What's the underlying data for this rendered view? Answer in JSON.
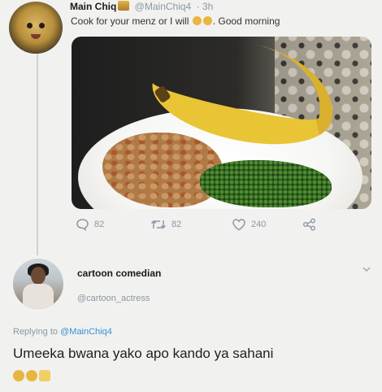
{
  "tweet": {
    "author_name": "Main Chiq",
    "handle": "@MainChiq4",
    "time": "· 3h",
    "text_a": "Cook for your menz or I will",
    "text_b": ". Good morning",
    "icons": {
      "badge": "gold-badge-icon",
      "emoji": "grinning-emoji-icon"
    }
  },
  "actions": {
    "reply_count": "82",
    "retweet_count": "82",
    "like_count": "240"
  },
  "reply": {
    "author_name": "cartoon comedian",
    "handle": "@cartoon_actress",
    "replying_prefix": "Replying to",
    "replying_mention": "@MainChiq4",
    "text": "Umeeka bwana yako apo kando ya sahani",
    "emojis": [
      "tears-of-joy-emoji",
      "tears-of-joy-emoji",
      "raised-hands-emoji"
    ]
  },
  "colors": {
    "link": "#3a8fd4",
    "muted": "#8b98a5"
  }
}
